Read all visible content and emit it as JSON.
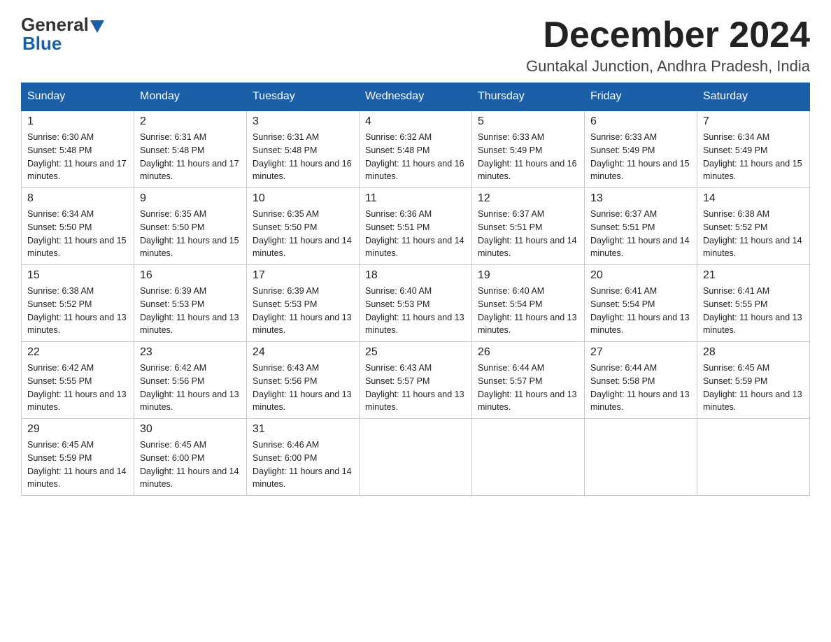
{
  "header": {
    "logo": {
      "general": "General",
      "blue": "Blue"
    },
    "title": "December 2024",
    "location": "Guntakal Junction, Andhra Pradesh, India"
  },
  "calendar": {
    "days_of_week": [
      "Sunday",
      "Monday",
      "Tuesday",
      "Wednesday",
      "Thursday",
      "Friday",
      "Saturday"
    ],
    "weeks": [
      [
        {
          "day": "1",
          "sunrise": "Sunrise: 6:30 AM",
          "sunset": "Sunset: 5:48 PM",
          "daylight": "Daylight: 11 hours and 17 minutes."
        },
        {
          "day": "2",
          "sunrise": "Sunrise: 6:31 AM",
          "sunset": "Sunset: 5:48 PM",
          "daylight": "Daylight: 11 hours and 17 minutes."
        },
        {
          "day": "3",
          "sunrise": "Sunrise: 6:31 AM",
          "sunset": "Sunset: 5:48 PM",
          "daylight": "Daylight: 11 hours and 16 minutes."
        },
        {
          "day": "4",
          "sunrise": "Sunrise: 6:32 AM",
          "sunset": "Sunset: 5:48 PM",
          "daylight": "Daylight: 11 hours and 16 minutes."
        },
        {
          "day": "5",
          "sunrise": "Sunrise: 6:33 AM",
          "sunset": "Sunset: 5:49 PM",
          "daylight": "Daylight: 11 hours and 16 minutes."
        },
        {
          "day": "6",
          "sunrise": "Sunrise: 6:33 AM",
          "sunset": "Sunset: 5:49 PM",
          "daylight": "Daylight: 11 hours and 15 minutes."
        },
        {
          "day": "7",
          "sunrise": "Sunrise: 6:34 AM",
          "sunset": "Sunset: 5:49 PM",
          "daylight": "Daylight: 11 hours and 15 minutes."
        }
      ],
      [
        {
          "day": "8",
          "sunrise": "Sunrise: 6:34 AM",
          "sunset": "Sunset: 5:50 PM",
          "daylight": "Daylight: 11 hours and 15 minutes."
        },
        {
          "day": "9",
          "sunrise": "Sunrise: 6:35 AM",
          "sunset": "Sunset: 5:50 PM",
          "daylight": "Daylight: 11 hours and 15 minutes."
        },
        {
          "day": "10",
          "sunrise": "Sunrise: 6:35 AM",
          "sunset": "Sunset: 5:50 PM",
          "daylight": "Daylight: 11 hours and 14 minutes."
        },
        {
          "day": "11",
          "sunrise": "Sunrise: 6:36 AM",
          "sunset": "Sunset: 5:51 PM",
          "daylight": "Daylight: 11 hours and 14 minutes."
        },
        {
          "day": "12",
          "sunrise": "Sunrise: 6:37 AM",
          "sunset": "Sunset: 5:51 PM",
          "daylight": "Daylight: 11 hours and 14 minutes."
        },
        {
          "day": "13",
          "sunrise": "Sunrise: 6:37 AM",
          "sunset": "Sunset: 5:51 PM",
          "daylight": "Daylight: 11 hours and 14 minutes."
        },
        {
          "day": "14",
          "sunrise": "Sunrise: 6:38 AM",
          "sunset": "Sunset: 5:52 PM",
          "daylight": "Daylight: 11 hours and 14 minutes."
        }
      ],
      [
        {
          "day": "15",
          "sunrise": "Sunrise: 6:38 AM",
          "sunset": "Sunset: 5:52 PM",
          "daylight": "Daylight: 11 hours and 13 minutes."
        },
        {
          "day": "16",
          "sunrise": "Sunrise: 6:39 AM",
          "sunset": "Sunset: 5:53 PM",
          "daylight": "Daylight: 11 hours and 13 minutes."
        },
        {
          "day": "17",
          "sunrise": "Sunrise: 6:39 AM",
          "sunset": "Sunset: 5:53 PM",
          "daylight": "Daylight: 11 hours and 13 minutes."
        },
        {
          "day": "18",
          "sunrise": "Sunrise: 6:40 AM",
          "sunset": "Sunset: 5:53 PM",
          "daylight": "Daylight: 11 hours and 13 minutes."
        },
        {
          "day": "19",
          "sunrise": "Sunrise: 6:40 AM",
          "sunset": "Sunset: 5:54 PM",
          "daylight": "Daylight: 11 hours and 13 minutes."
        },
        {
          "day": "20",
          "sunrise": "Sunrise: 6:41 AM",
          "sunset": "Sunset: 5:54 PM",
          "daylight": "Daylight: 11 hours and 13 minutes."
        },
        {
          "day": "21",
          "sunrise": "Sunrise: 6:41 AM",
          "sunset": "Sunset: 5:55 PM",
          "daylight": "Daylight: 11 hours and 13 minutes."
        }
      ],
      [
        {
          "day": "22",
          "sunrise": "Sunrise: 6:42 AM",
          "sunset": "Sunset: 5:55 PM",
          "daylight": "Daylight: 11 hours and 13 minutes."
        },
        {
          "day": "23",
          "sunrise": "Sunrise: 6:42 AM",
          "sunset": "Sunset: 5:56 PM",
          "daylight": "Daylight: 11 hours and 13 minutes."
        },
        {
          "day": "24",
          "sunrise": "Sunrise: 6:43 AM",
          "sunset": "Sunset: 5:56 PM",
          "daylight": "Daylight: 11 hours and 13 minutes."
        },
        {
          "day": "25",
          "sunrise": "Sunrise: 6:43 AM",
          "sunset": "Sunset: 5:57 PM",
          "daylight": "Daylight: 11 hours and 13 minutes."
        },
        {
          "day": "26",
          "sunrise": "Sunrise: 6:44 AM",
          "sunset": "Sunset: 5:57 PM",
          "daylight": "Daylight: 11 hours and 13 minutes."
        },
        {
          "day": "27",
          "sunrise": "Sunrise: 6:44 AM",
          "sunset": "Sunset: 5:58 PM",
          "daylight": "Daylight: 11 hours and 13 minutes."
        },
        {
          "day": "28",
          "sunrise": "Sunrise: 6:45 AM",
          "sunset": "Sunset: 5:59 PM",
          "daylight": "Daylight: 11 hours and 13 minutes."
        }
      ],
      [
        {
          "day": "29",
          "sunrise": "Sunrise: 6:45 AM",
          "sunset": "Sunset: 5:59 PM",
          "daylight": "Daylight: 11 hours and 14 minutes."
        },
        {
          "day": "30",
          "sunrise": "Sunrise: 6:45 AM",
          "sunset": "Sunset: 6:00 PM",
          "daylight": "Daylight: 11 hours and 14 minutes."
        },
        {
          "day": "31",
          "sunrise": "Sunrise: 6:46 AM",
          "sunset": "Sunset: 6:00 PM",
          "daylight": "Daylight: 11 hours and 14 minutes."
        },
        null,
        null,
        null,
        null
      ]
    ]
  }
}
